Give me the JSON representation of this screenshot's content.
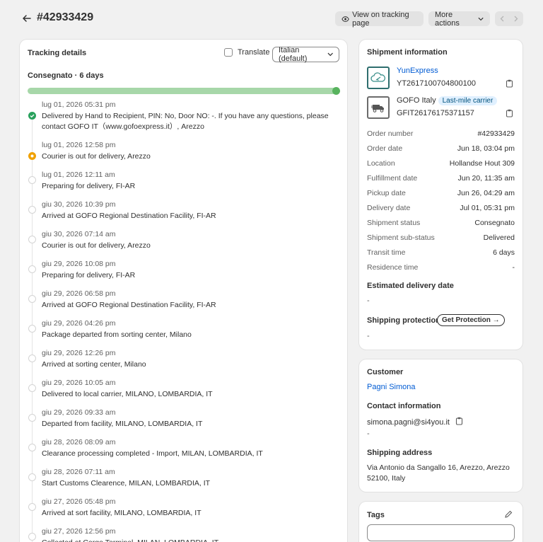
{
  "header": {
    "order_title": "#42933429",
    "view_tracking_label": "View on tracking page",
    "more_actions_label": "More actions"
  },
  "tracking": {
    "title": "Tracking details",
    "translate_label": "Translate",
    "language": "Italian (default)",
    "status_line": "Consegnato · 6 days",
    "progress": 1.0,
    "events": [
      {
        "time": "lug 01, 2026 05:31 pm",
        "desc": "Delivered by Hand to Recipient, PIN: No, Door NO: -. If you have any questions, please contact GOFO IT（www.gofoexpress.it）, Arezzo",
        "state": "done"
      },
      {
        "time": "lug 01, 2026 12:58 pm",
        "desc": "Courier is out for delivery, Arezzo",
        "state": "out"
      },
      {
        "time": "lug 01, 2026 12:11 am",
        "desc": "Preparing for delivery, FI-AR",
        "state": ""
      },
      {
        "time": "giu 30, 2026 10:39 pm",
        "desc": "Arrived at GOFO Regional Destination Facility, FI-AR",
        "state": ""
      },
      {
        "time": "giu 30, 2026 07:14 am",
        "desc": "Courier is out for delivery, Arezzo",
        "state": ""
      },
      {
        "time": "giu 29, 2026 10:08 pm",
        "desc": "Preparing for delivery, FI-AR",
        "state": ""
      },
      {
        "time": "giu 29, 2026 06:58 pm",
        "desc": "Arrived at GOFO Regional Destination Facility, FI-AR",
        "state": ""
      },
      {
        "time": "giu 29, 2026 04:26 pm",
        "desc": "Package departed from sorting center, Milano",
        "state": ""
      },
      {
        "time": "giu 29, 2026 12:26 pm",
        "desc": "Arrived at sorting center, Milano",
        "state": ""
      },
      {
        "time": "giu 29, 2026 10:05 am",
        "desc": "Delivered to local carrier, MILANO, LOMBARDIA, IT",
        "state": ""
      },
      {
        "time": "giu 29, 2026 09:33 am",
        "desc": "Departed from facility, MILANO, LOMBARDIA, IT",
        "state": ""
      },
      {
        "time": "giu 28, 2026 08:09 am",
        "desc": "Clearance processing completed - Import, MILAN, LOMBARDIA, IT",
        "state": ""
      },
      {
        "time": "giu 28, 2026 07:11 am",
        "desc": "Start Customs Clearence, MILAN, LOMBARDIA, IT",
        "state": ""
      },
      {
        "time": "giu 27, 2026 05:48 pm",
        "desc": "Arrived at sort facility, MILANO, LOMBARDIA, IT",
        "state": ""
      },
      {
        "time": "giu 27, 2026 12:56 pm",
        "desc": "Collected at Cargo Terminal, MILAN, LOMBARDIA, IT",
        "state": ""
      }
    ]
  },
  "shipment": {
    "title": "Shipment information",
    "carriers": [
      {
        "name": "YunExpress",
        "tracking": "YT2617100704800100",
        "badge": ""
      },
      {
        "name": "GOFO Italy",
        "tracking": "GFIT26176175371157",
        "badge": "Last-mile carrier"
      }
    ],
    "rows": [
      {
        "label": "Order number",
        "value": "#42933429",
        "link": true
      },
      {
        "label": "Order date",
        "value": "Jun 18, 03:04 pm"
      },
      {
        "label": "Location",
        "value": "Hollandse Hout 309"
      },
      {
        "label": "Fulfillment date",
        "value": "Jun 20, 11:35 am"
      },
      {
        "label": "Pickup date",
        "value": "Jun 26, 04:29 am"
      },
      {
        "label": "Delivery date",
        "value": "Jul 01, 05:31 pm"
      },
      {
        "label": "Shipment status",
        "value": "Consegnato"
      },
      {
        "label": "Shipment sub-status",
        "value": "Delivered"
      },
      {
        "label": "Transit time",
        "value": "6 days"
      },
      {
        "label": "Residence time",
        "value": "-"
      }
    ],
    "estimated_title": "Estimated delivery date",
    "estimated_value": "-",
    "protection_title": "Shipping protection",
    "protection_button": "Get Protection →",
    "protection_value": "-"
  },
  "customer": {
    "title": "Customer",
    "name": "Pagni Simona",
    "contact_title": "Contact information",
    "email": "simona.pagni@si4you.it",
    "phone": "-",
    "address_title": "Shipping address",
    "address": "Via Antonio da Sangallo 16, Arezzo, Arezzo 52100, Italy"
  },
  "tags": {
    "title": "Tags"
  }
}
